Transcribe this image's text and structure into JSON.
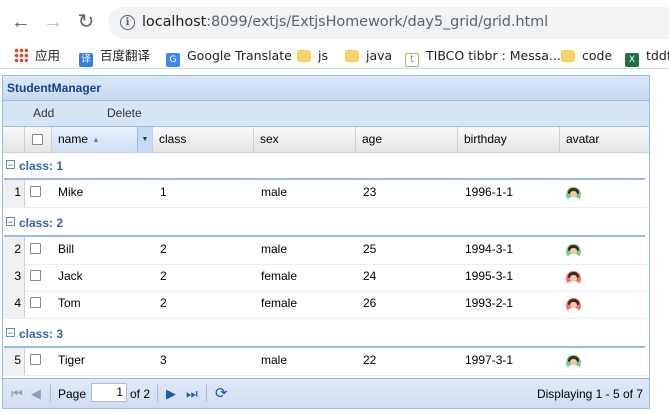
{
  "browser": {
    "url_host": "localhost",
    "url_rest": ":8099/extjs/ExtjsHomework/day5_grid/grid.html",
    "bookmarks": [
      {
        "label": "应用",
        "icon": "apps-grid-icon"
      },
      {
        "label": "百度翻译",
        "icon": "baidu-translate-icon"
      },
      {
        "label": "Google Translate",
        "icon": "google-translate-icon"
      },
      {
        "label": "js",
        "icon": "folder-icon"
      },
      {
        "label": "java",
        "icon": "folder-icon"
      },
      {
        "label": "TIBCO tibbr : Messa...",
        "icon": "tibbr-icon"
      },
      {
        "label": "code",
        "icon": "folder-icon"
      },
      {
        "label": "tddf",
        "icon": "excel-icon"
      }
    ]
  },
  "panel": {
    "title": "StudentManager"
  },
  "toolbar": {
    "add_label": "Add",
    "delete_label": "Delete"
  },
  "columns": {
    "name": "name",
    "class": "class",
    "sex": "sex",
    "age": "age",
    "birthday": "birthday",
    "avatar": "avatar"
  },
  "groups": [
    {
      "label": "class: 1",
      "rows": [
        {
          "n": "1",
          "name": "Mike",
          "cls": "1",
          "sex": "male",
          "age": "23",
          "birthday": "1996-1-1",
          "avatar_color": "#6fd08c"
        }
      ]
    },
    {
      "label": "class: 2",
      "rows": [
        {
          "n": "2",
          "name": "Bill",
          "cls": "2",
          "sex": "male",
          "age": "25",
          "birthday": "1994-3-1",
          "avatar_color": "#6fd08c"
        },
        {
          "n": "3",
          "name": "Jack",
          "cls": "2",
          "sex": "female",
          "age": "24",
          "birthday": "1995-3-1",
          "avatar_color": "#f06f6f"
        },
        {
          "n": "4",
          "name": "Tom",
          "cls": "2",
          "sex": "female",
          "age": "26",
          "birthday": "1993-2-1",
          "avatar_color": "#f06f6f"
        }
      ]
    },
    {
      "label": "class: 3",
      "rows": [
        {
          "n": "5",
          "name": "Tiger",
          "cls": "3",
          "sex": "male",
          "age": "22",
          "birthday": "1997-3-1",
          "avatar_color": "#6fd08c"
        }
      ]
    }
  ],
  "paging": {
    "page_label": "Page",
    "page_value": "1",
    "of_label": "of 2",
    "display": "Displaying 1 - 5 of 7"
  }
}
